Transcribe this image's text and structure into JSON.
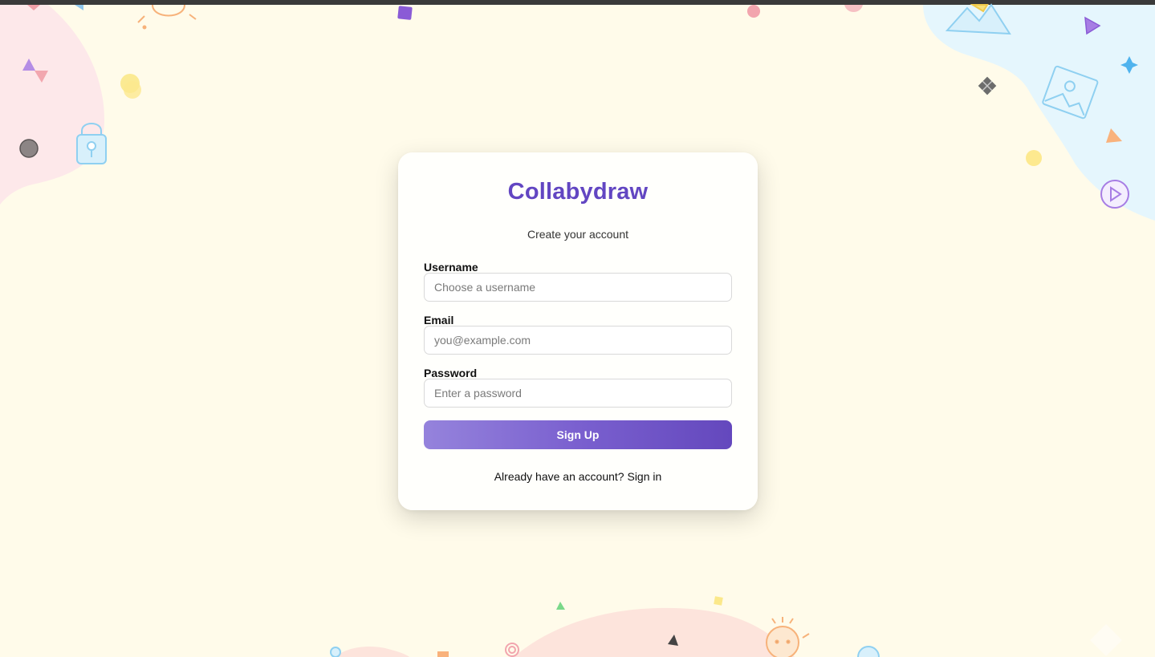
{
  "app": {
    "brand": "Collabydraw",
    "subtitle": "Create your account"
  },
  "form": {
    "username": {
      "label": "Username",
      "placeholder": "Choose a username"
    },
    "email": {
      "label": "Email",
      "placeholder": "you@example.com"
    },
    "password": {
      "label": "Password",
      "placeholder": "Enter a password"
    },
    "submit_label": "Sign Up"
  },
  "footer": {
    "prompt": "Already have an account?",
    "link": "Sign in"
  },
  "colors": {
    "background": "#fffbea",
    "brand": "#6246c2",
    "button_gradient_start": "#9583dc",
    "button_gradient_end": "#6448bd"
  },
  "decorations": {
    "icons": [
      "lock-icon",
      "mountain-picture-icon",
      "play-circle-icon",
      "sun-doodle-icon",
      "sparkle-icon",
      "triangle-shape",
      "circle-shape",
      "square-shape"
    ]
  }
}
